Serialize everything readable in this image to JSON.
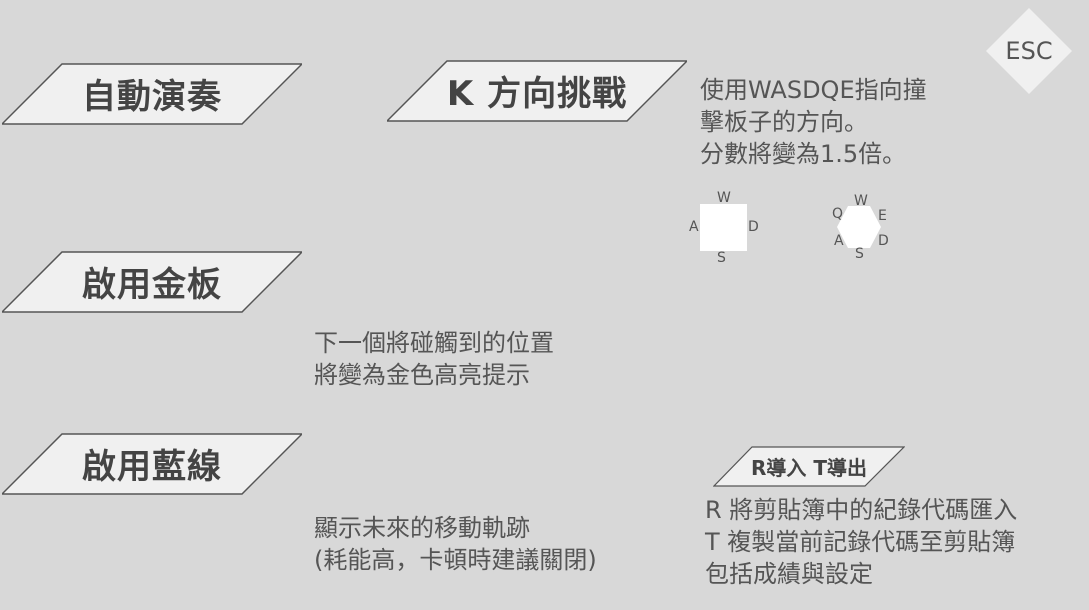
{
  "esc": {
    "label": "ESC"
  },
  "options": {
    "autoplay": {
      "label": "自動演奏"
    },
    "direction": {
      "label": "K 方向挑戰",
      "desc": [
        "使用WASDQE指向撞",
        "擊板子的方向。",
        "分數將變為1.5倍。"
      ]
    },
    "golden": {
      "label": "啟用金板",
      "desc": [
        "下一個將碰觸到的位置",
        "將變為金色高亮提示"
      ]
    },
    "blueline": {
      "label": "啟用藍線",
      "desc": [
        "顯示未來的移動軌跡",
        "(耗能高，卡頓時建議關閉)"
      ]
    },
    "importexport": {
      "label": "R導入 T導出",
      "desc": [
        "R 將剪貼簿中的紀錄代碼匯入",
        "T 複製當前記錄代碼至剪貼簿",
        "包括成績與設定"
      ]
    }
  },
  "key_diagram": {
    "square": {
      "w": "W",
      "a": "A",
      "s": "S",
      "d": "D"
    },
    "hex": {
      "q": "Q",
      "w": "W",
      "e": "E",
      "a": "A",
      "s": "S",
      "d": "D"
    }
  },
  "colors": {
    "background": "#d8d8d8",
    "button_fill": "#f0f0f0",
    "button_stroke": "#555555",
    "text": "#4d4d4d"
  }
}
